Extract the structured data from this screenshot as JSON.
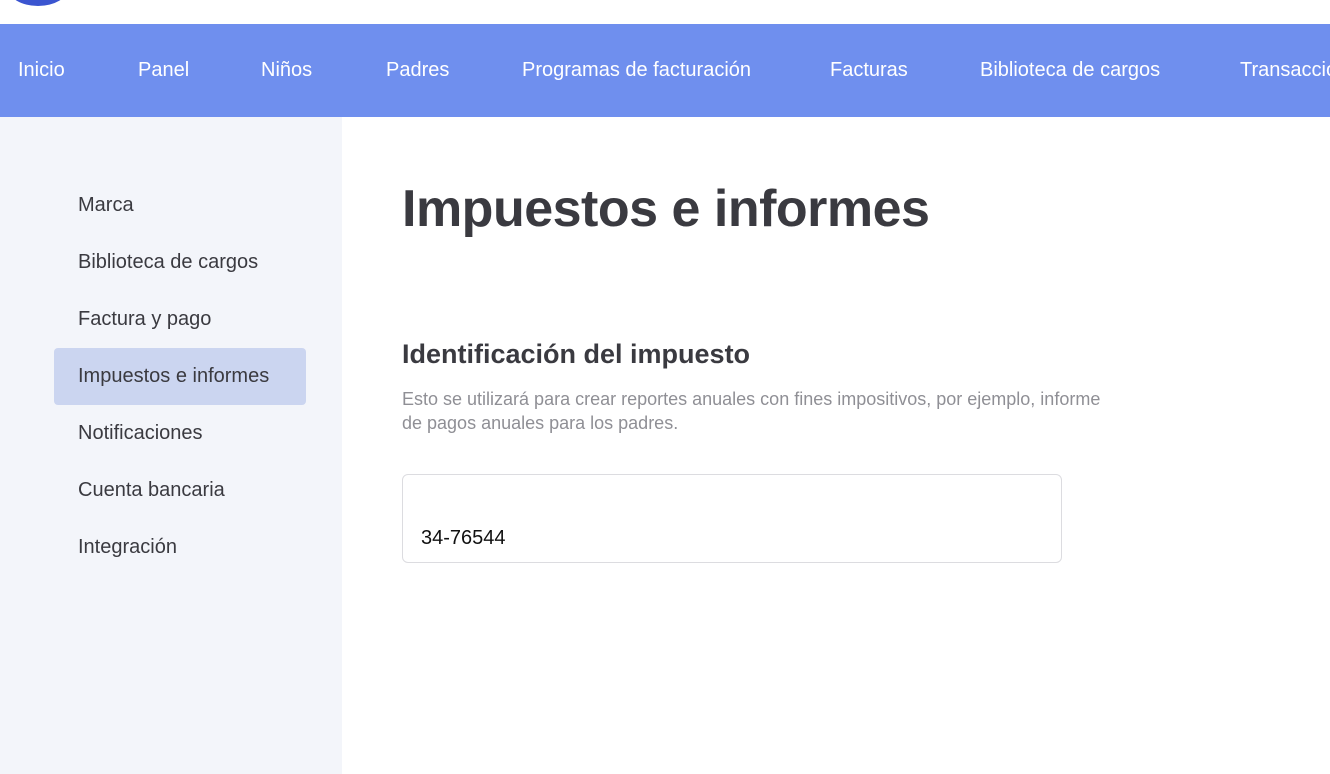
{
  "nav": {
    "items": [
      {
        "label": "Inicio"
      },
      {
        "label": "Panel"
      },
      {
        "label": "Niños"
      },
      {
        "label": "Padres"
      },
      {
        "label": "Programas de facturación"
      },
      {
        "label": "Facturas"
      },
      {
        "label": "Biblioteca de cargos"
      },
      {
        "label": "Transacciones"
      }
    ]
  },
  "sidebar": {
    "items": [
      {
        "label": "Marca"
      },
      {
        "label": "Biblioteca de cargos"
      },
      {
        "label": "Factura y pago"
      },
      {
        "label": "Impuestos e informes"
      },
      {
        "label": "Notificaciones"
      },
      {
        "label": "Cuenta bancaria"
      },
      {
        "label": "Integración"
      }
    ],
    "active_label": "Impuestos e informes"
  },
  "main": {
    "title": "Impuestos e informes",
    "section_title": "Identificación del impuesto",
    "section_description": "Esto se utilizará para crear reportes anuales con fines impositivos, por ejemplo, informe de pagos anuales para los padres.",
    "tax_id_value": "34-76544"
  },
  "colors": {
    "nav_background": "#6f8fee",
    "sidebar_background": "#f3f5fa",
    "sidebar_active": "#cbd5f0",
    "logo": "#3b55d0"
  }
}
